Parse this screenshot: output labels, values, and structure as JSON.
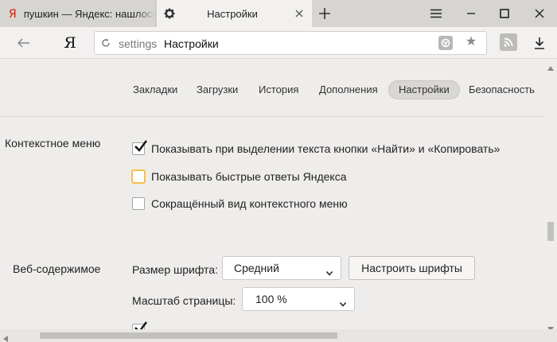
{
  "tabs": [
    {
      "title": "пушкин — Яндекс: нашлось",
      "favicon": "yandex-logo-icon",
      "active": false
    },
    {
      "title": "Настройки",
      "favicon": "gear-icon",
      "active": true
    }
  ],
  "window_controls": [
    "menu-icon",
    "minimize-icon",
    "maximize-icon",
    "close-icon"
  ],
  "toolbar": {
    "logo": "Я",
    "url_scheme": "settings",
    "url_title": "Настройки"
  },
  "nav": {
    "tabs": [
      "Закладки",
      "Загрузки",
      "История",
      "Дополнения",
      "Настройки",
      "Безопасность"
    ],
    "active": "Настройки"
  },
  "context_menu": {
    "title": "Контекстное меню",
    "options": [
      {
        "label": "Показывать при выделении текста кнопки «Найти» и «Копировать»",
        "checked": true
      },
      {
        "label": "Показывать быстрые ответы Яндекса",
        "checked": false
      },
      {
        "label": "Сокращённый вид контекстного меню",
        "checked": false
      }
    ]
  },
  "web_content": {
    "title": "Веб-содержимое",
    "font_size_label": "Размер шрифта:",
    "font_size_value": "Средний",
    "configure_fonts_button": "Настроить шрифты",
    "page_zoom_label": "Масштаб страницы:",
    "page_zoom_value": "100 %"
  },
  "colors": {
    "checkbox_focus": "#f5c14a",
    "yandex_red": "#e61400"
  }
}
